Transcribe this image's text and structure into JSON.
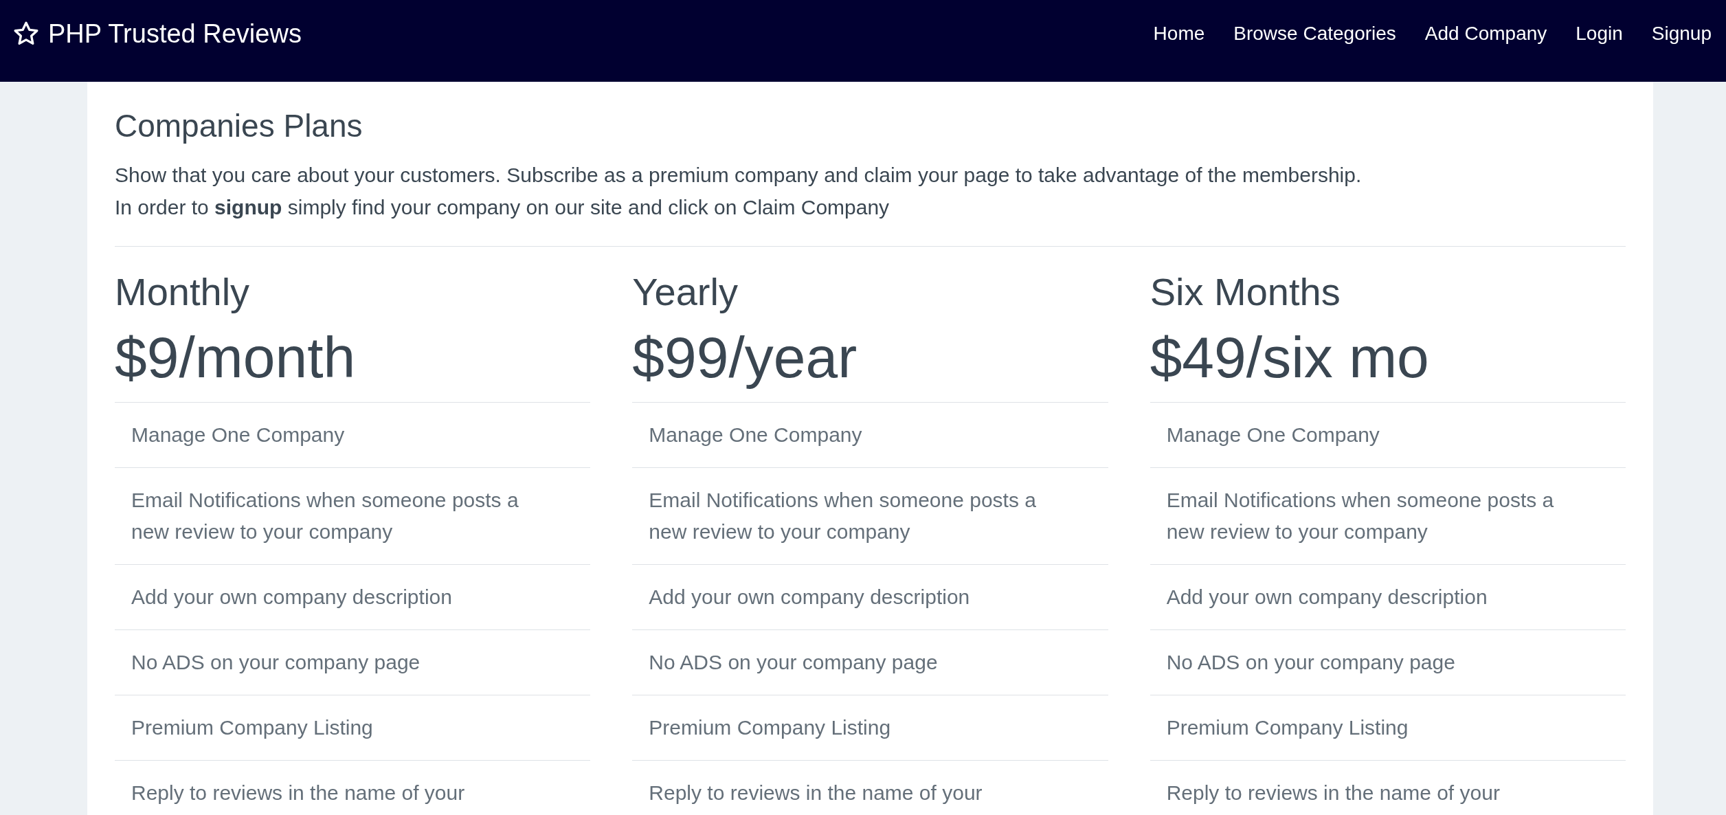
{
  "navbar": {
    "brand": "PHP Trusted Reviews",
    "links": [
      "Home",
      "Browse Categories",
      "Add Company",
      "Login",
      "Signup"
    ]
  },
  "page": {
    "title": "Companies Plans",
    "intro": [
      "Show that you care about your customers. Subscribe as a premium company and claim your page to take advantage of the membership.",
      "In order to **signup** simply find your company on our site and click on Claim Company"
    ]
  },
  "plans": [
    {
      "name": "Monthly",
      "price": "$9/month",
      "features": [
        "Manage One Company",
        "Email Notifications when someone posts a new review to your company",
        "Add your own company description",
        "No ADS on your company page",
        "Premium Company Listing",
        "Reply to reviews in the name of your"
      ]
    },
    {
      "name": "Yearly",
      "price": "$99/year",
      "features": [
        "Manage One Company",
        "Email Notifications when someone posts a new review to your company",
        "Add your own company description",
        "No ADS on your company page",
        "Premium Company Listing",
        "Reply to reviews in the name of your"
      ]
    },
    {
      "name": "Six Months",
      "price": "$49/six mo",
      "features": [
        "Manage One Company",
        "Email Notifications when someone posts a new review to your company",
        "Add your own company description",
        "No ADS on your company page",
        "Premium Company Listing",
        "Reply to reviews in the name of your"
      ]
    }
  ]
}
